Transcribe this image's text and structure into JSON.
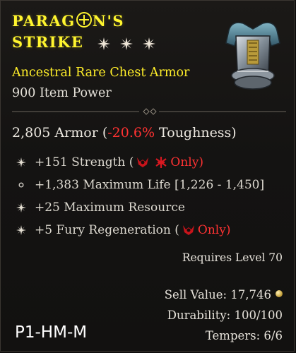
{
  "item": {
    "name_line1": "Paragon's",
    "name_line2": "Strike",
    "subtype": "Ancestral Rare Chest Armor",
    "item_power": "900 Item Power",
    "armor_value": "2,805 Armor (",
    "toughness_delta": "-20.6%",
    "toughness_label": " Toughness)",
    "affixes": [
      {
        "pre": "+151 Strength (",
        "class_only": "Only)",
        "icons": [
          "barbarian-icon",
          "druid-icon"
        ]
      },
      {
        "pre": "+1,383 Maximum Life [1,226 - 1,450]"
      },
      {
        "pre": "+25 Maximum Resource"
      },
      {
        "pre": "+5 Fury Regeneration (",
        "class_only": "Only)",
        "icons": [
          "barbarian-icon"
        ]
      }
    ],
    "requires_level": "Requires Level 70",
    "sell_value": "Sell Value: 17,746",
    "durability": "Durability: 100/100",
    "tempers": "Tempers: 6/6",
    "build_tag": "P1-HM-M"
  },
  "colors": {
    "rare_yellow": "#fff52e",
    "negative_red": "#ff3232",
    "text": "#e6e2da"
  }
}
